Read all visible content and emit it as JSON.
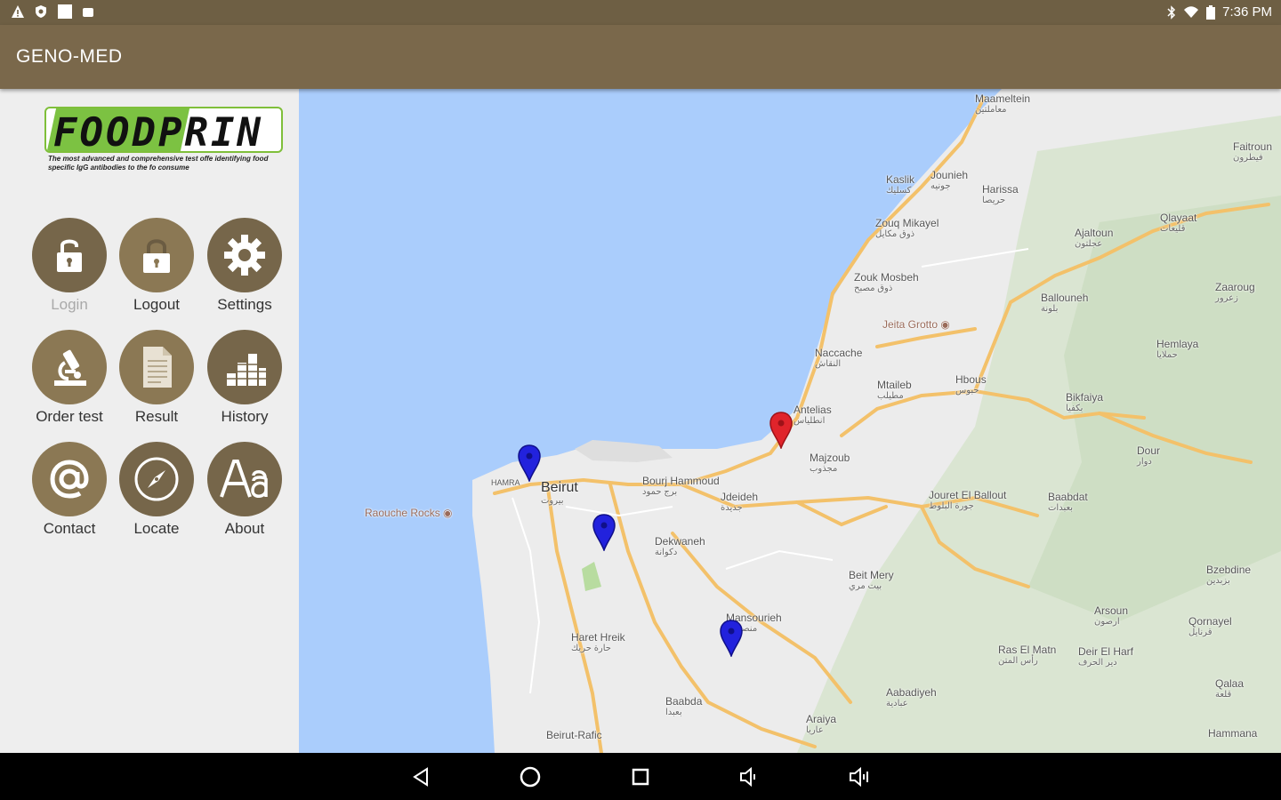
{
  "status_bar": {
    "time": "7:36 PM",
    "left_icons": [
      "warning-icon",
      "shield-icon",
      "square-icon",
      "robot-icon"
    ],
    "right_icons": [
      "bluetooth-icon",
      "wifi-icon",
      "battery-icon"
    ]
  },
  "app_bar": {
    "title": "GENO-MED"
  },
  "logo": {
    "brand": "FOODPRIN",
    "tagline": "The most advanced and comprehensive test offe identifying food specific IgG antibodies to the fo consume"
  },
  "menu": [
    {
      "id": "login",
      "label": "Login",
      "icon": "unlock-icon",
      "enabled": false
    },
    {
      "id": "logout",
      "label": "Logout",
      "icon": "lock-icon",
      "enabled": true
    },
    {
      "id": "settings",
      "label": "Settings",
      "icon": "gear-icon",
      "enabled": true
    },
    {
      "id": "order-test",
      "label": "Order test",
      "icon": "microscope-icon",
      "enabled": true
    },
    {
      "id": "result",
      "label": "Result",
      "icon": "document-icon",
      "enabled": true
    },
    {
      "id": "history",
      "label": "History",
      "icon": "bar-chart-icon",
      "enabled": true
    },
    {
      "id": "contact",
      "label": "Contact",
      "icon": "at-sign-icon",
      "enabled": true
    },
    {
      "id": "locate",
      "label": "Locate",
      "icon": "compass-icon",
      "enabled": true
    },
    {
      "id": "about",
      "label": "About",
      "icon": "font-icon",
      "enabled": true
    }
  ],
  "map": {
    "places": [
      {
        "name": "Maameltein",
        "ar": "معاملتين"
      },
      {
        "name": "Jounieh",
        "ar": "جونيه"
      },
      {
        "name": "Kaslik",
        "ar": "كسليك"
      },
      {
        "name": "Harissa",
        "ar": "حريصا"
      },
      {
        "name": "Faitroun",
        "ar": "فيطرون"
      },
      {
        "name": "Zouq Mikayel",
        "ar": "ذوق مكايل"
      },
      {
        "name": "Qlayaat",
        "ar": "قليعات"
      },
      {
        "name": "Ajaltoun",
        "ar": "عجلتون"
      },
      {
        "name": "Zouk Mosbeh",
        "ar": "ذوق مصبح"
      },
      {
        "name": "Zaaroug",
        "ar": "زعرور"
      },
      {
        "name": "Ballouneh",
        "ar": "بلونة"
      },
      {
        "name": "Jeita Grotto",
        "ar": ""
      },
      {
        "name": "Naccache",
        "ar": "النقاش"
      },
      {
        "name": "Mtaileb",
        "ar": "مطيلب"
      },
      {
        "name": "Hbous",
        "ar": "حبوس"
      },
      {
        "name": "Bikfaiya",
        "ar": "بكفيا"
      },
      {
        "name": "Antelias",
        "ar": "انطلياس"
      },
      {
        "name": "Hemlaya",
        "ar": "حملايا"
      },
      {
        "name": "Dour",
        "ar": "دوار"
      },
      {
        "name": "Majzoub",
        "ar": "مجذوب"
      },
      {
        "name": "Beirut",
        "ar": "بيروت"
      },
      {
        "name": "HAMRA",
        "ar": ""
      },
      {
        "name": "Bourj Hammoud",
        "ar": "برج حمود"
      },
      {
        "name": "Jdeideh",
        "ar": "جديدة"
      },
      {
        "name": "Jouret El Ballout",
        "ar": "جورة البلوط"
      },
      {
        "name": "Baabdat",
        "ar": "بعبدات"
      },
      {
        "name": "Raouche Rocks",
        "ar": ""
      },
      {
        "name": "Dekwaneh",
        "ar": "دكوانة"
      },
      {
        "name": "Beit Mery",
        "ar": "بيت مري"
      },
      {
        "name": "Bzebdine",
        "ar": "بزبدين"
      },
      {
        "name": "Mansourieh",
        "ar": "منصورية"
      },
      {
        "name": "Arsoun",
        "ar": "ارصون"
      },
      {
        "name": "Qornayel",
        "ar": "قرنايل"
      },
      {
        "name": "Haret Hreik",
        "ar": "حارة حريك"
      },
      {
        "name": "Ras El Matn",
        "ar": "رأس المتن"
      },
      {
        "name": "Deir El Harf",
        "ar": "دير الحرف"
      },
      {
        "name": "Aabadiyeh",
        "ar": "عبادية"
      },
      {
        "name": "Qalaa",
        "ar": "قلعة"
      },
      {
        "name": "Baabda",
        "ar": "بعبدا"
      },
      {
        "name": "Araiya",
        "ar": "عاريا"
      },
      {
        "name": "Beirut-Rafic",
        "ar": ""
      },
      {
        "name": "Hammana",
        "ar": ""
      }
    ],
    "markers": [
      {
        "name": "clinic-marker-hamra",
        "color": "#2222dd"
      },
      {
        "name": "clinic-marker-achrafieh",
        "color": "#2222dd"
      },
      {
        "name": "clinic-marker-mansourieh",
        "color": "#2222dd"
      },
      {
        "name": "current-location-marker",
        "color": "#e0242b"
      }
    ],
    "colors": {
      "sea": "#aacdfc",
      "land": "#ececec",
      "road": "#f3c16a"
    }
  },
  "nav_bar": {
    "buttons": [
      "back-icon",
      "home-icon",
      "recents-icon",
      "volume-down-icon",
      "volume-up-icon"
    ]
  }
}
